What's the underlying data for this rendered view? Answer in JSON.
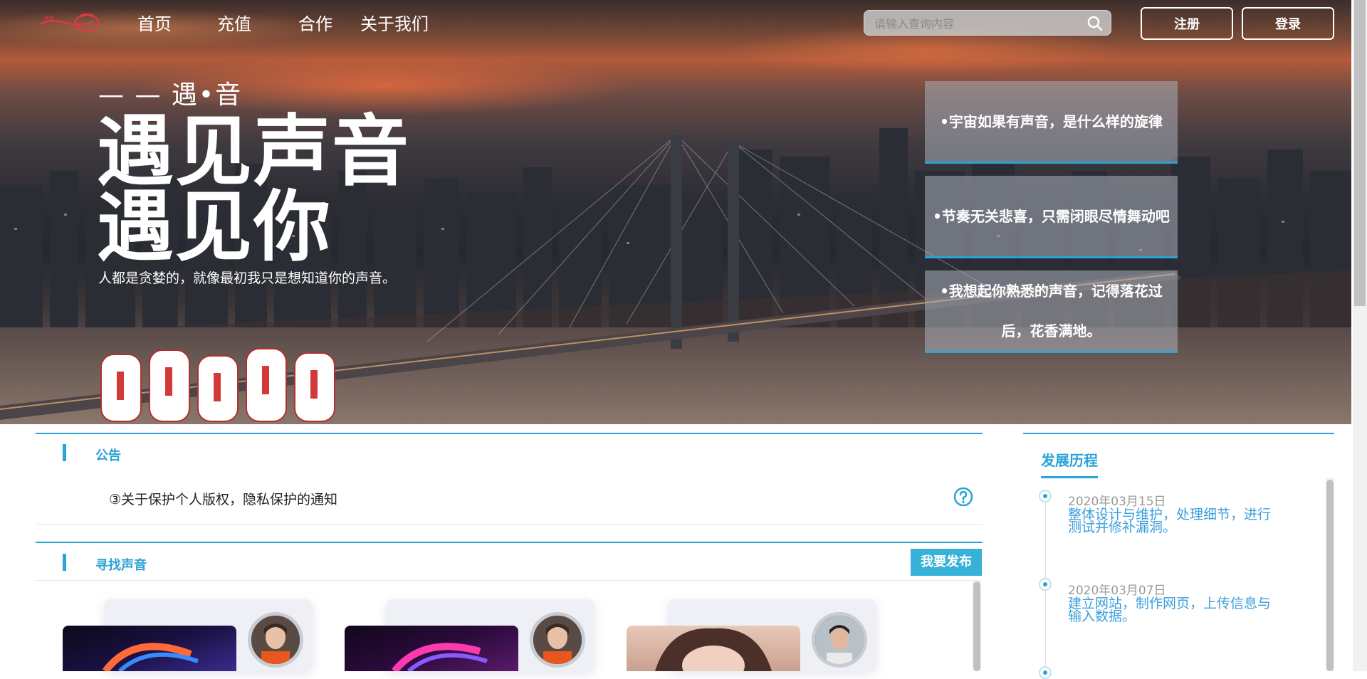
{
  "nav": {
    "items": [
      "首页",
      "充值",
      "合作",
      "关于我们"
    ],
    "search_placeholder": "请输入查询内容",
    "register_label": "注册",
    "login_label": "登录"
  },
  "hero": {
    "kicker": "— — 遇•音",
    "title_line1": "遇见声音",
    "title_line2": "遇见你",
    "subtitle": "人都是贪婪的，就像最初我只是想知道你的声音。",
    "quotes": [
      "•宇宙如果有声音，是什么样的旋律",
      "•节奏无关悲喜，只需闭眼尽情舞动吧",
      "•我想起你熟悉的声音，记得落花过后，花香满地。"
    ]
  },
  "notice": {
    "title": "公告",
    "text": "③关于保护个人版权，隐私保护的通知"
  },
  "find_voice": {
    "title": "寻找声音",
    "publish_label": "我要发布"
  },
  "timeline": {
    "title": "发展历程",
    "entries": [
      {
        "date": "2020年03月15日",
        "desc": "整体设计与维护，处理细节，进行测试并修补漏洞。"
      },
      {
        "date": "2020年03月07日",
        "desc": "建立网站，制作网页，上传信息与输入数据。"
      }
    ]
  },
  "colors": {
    "accent": "#2aa3d6",
    "publish_button": "#38b1d9",
    "timeline_text": "#3a9ede"
  }
}
